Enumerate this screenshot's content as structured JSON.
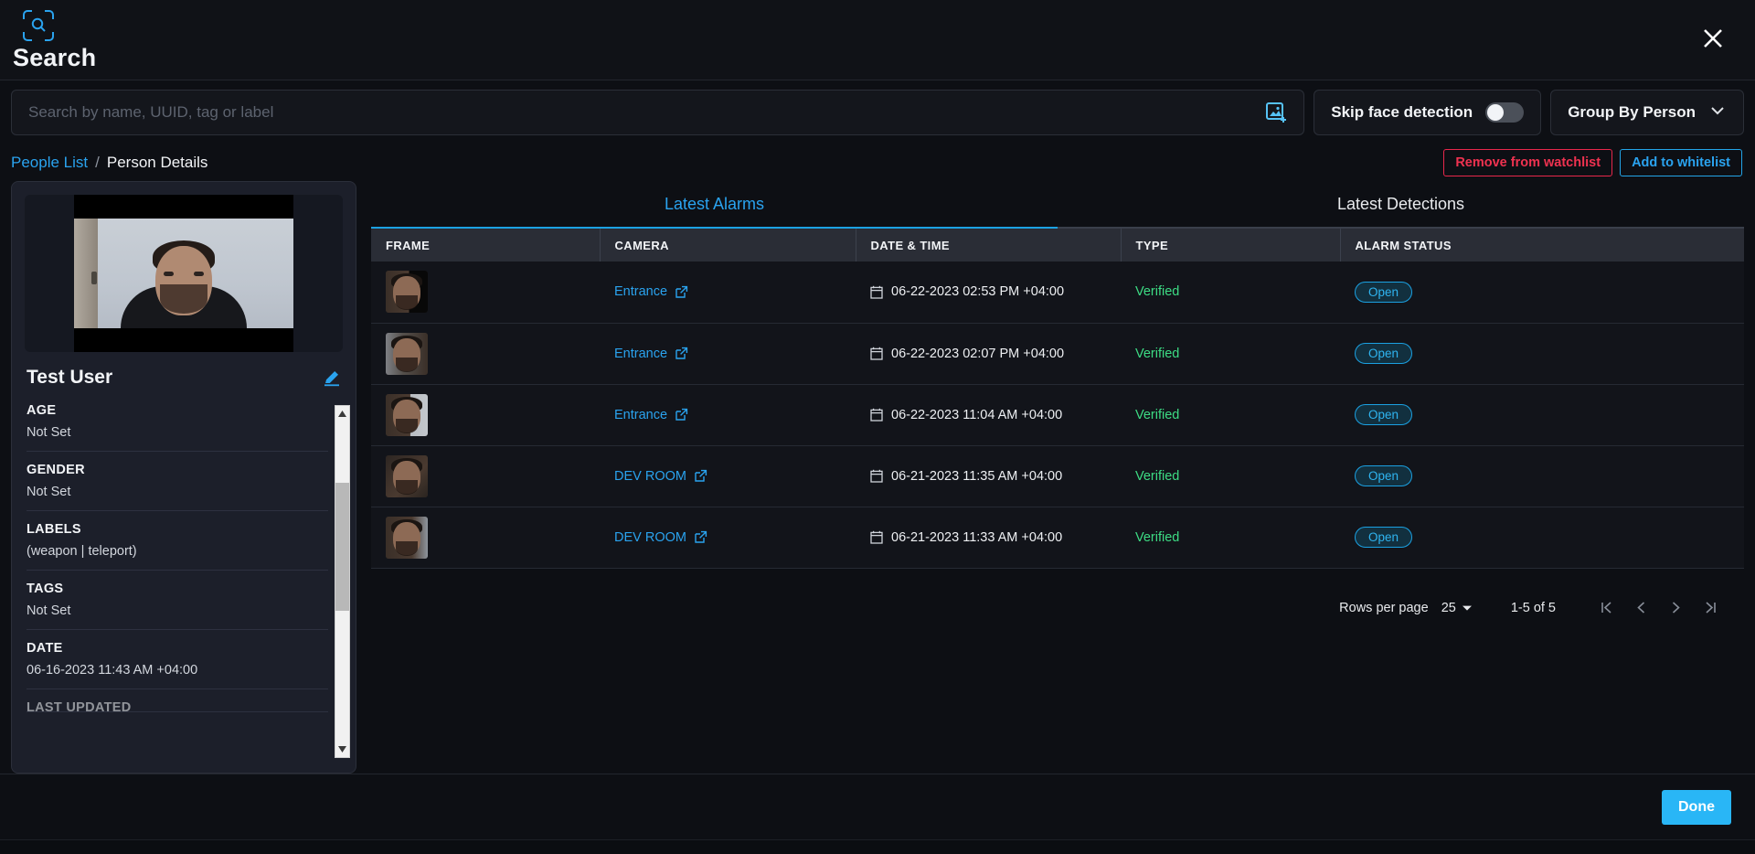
{
  "window": {
    "title": "Search",
    "search_badge_icon": "search-frame-icon",
    "close_icon": "close-icon"
  },
  "search": {
    "placeholder": "Search by name, UUID, tag or label",
    "value": "",
    "image_upload_icon": "image-add-icon",
    "skip_face_detection_label": "Skip face detection",
    "skip_face_detection_on": false,
    "group_by_label": "Group By Person",
    "group_by_chevron_icon": "chevron-down-icon"
  },
  "breadcrumb": {
    "root": "People List",
    "separator": "/",
    "current": "Person Details"
  },
  "actions": {
    "remove_watchlist": "Remove from watchlist",
    "add_whitelist": "Add to whitelist"
  },
  "person": {
    "name": "Test User",
    "edit_icon": "pencil-icon",
    "photo_alt": "person-portrait",
    "attributes": [
      {
        "key": "AGE",
        "value": "Not Set"
      },
      {
        "key": "GENDER",
        "value": "Not Set"
      },
      {
        "key": "LABELS",
        "value": "(weapon | teleport)"
      },
      {
        "key": "TAGS",
        "value": "Not Set"
      },
      {
        "key": "DATE",
        "value": "06-16-2023 11:43 AM +04:00"
      },
      {
        "key": "LAST UPDATED",
        "value": ""
      }
    ]
  },
  "tabs": [
    {
      "label": "Latest Alarms",
      "active": true
    },
    {
      "label": "Latest Detections",
      "active": false
    }
  ],
  "table": {
    "columns": [
      "FRAME",
      "CAMERA",
      "DATE & TIME",
      "TYPE",
      "ALARM STATUS"
    ],
    "rows": [
      {
        "camera": "Entrance",
        "datetime": "06-22-2023 02:53 PM +04:00",
        "type": "Verified",
        "status": "Open"
      },
      {
        "camera": "Entrance",
        "datetime": "06-22-2023 02:07 PM +04:00",
        "type": "Verified",
        "status": "Open"
      },
      {
        "camera": "Entrance",
        "datetime": "06-22-2023 11:04 AM +04:00",
        "type": "Verified",
        "status": "Open"
      },
      {
        "camera": "DEV ROOM",
        "datetime": "06-21-2023 11:35 AM +04:00",
        "type": "Verified",
        "status": "Open"
      },
      {
        "camera": "DEV ROOM",
        "datetime": "06-21-2023 11:33 AM +04:00",
        "type": "Verified",
        "status": "Open"
      }
    ]
  },
  "pagination": {
    "rows_per_page_label": "Rows per page",
    "rows_per_page_value": "25",
    "range": "1-5 of 5",
    "first_icon": "first-page-icon",
    "prev_icon": "prev-page-icon",
    "next_icon": "next-page-icon",
    "last_icon": "last-page-icon"
  },
  "footer": {
    "done": "Done"
  },
  "colors": {
    "accent": "#2aa3ef",
    "done_button": "#29b6f6",
    "danger": "#ef3250",
    "verified": "#3ddc84",
    "page_bg": "#0d0f14"
  }
}
